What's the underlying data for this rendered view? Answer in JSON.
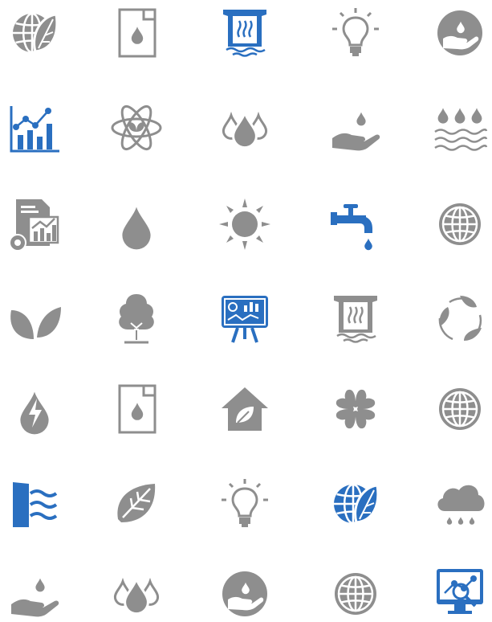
{
  "colors": {
    "gray": "#8e8e8e",
    "blue": "#2a6fc0",
    "white": "#ffffff"
  },
  "icons": [
    {
      "name": "globe-leaf-icon",
      "color": "gray"
    },
    {
      "name": "document-drop-icon",
      "color": "gray"
    },
    {
      "name": "dam-icon",
      "color": "blue"
    },
    {
      "name": "lightbulb-icon",
      "color": "gray"
    },
    {
      "name": "hand-water-circle-icon",
      "color": "gray"
    },
    {
      "name": "chart-growth-icon",
      "color": "blue"
    },
    {
      "name": "atom-leaf-icon",
      "color": "gray"
    },
    {
      "name": "triple-drops-icon",
      "color": "gray"
    },
    {
      "name": "hand-drop-icon",
      "color": "gray"
    },
    {
      "name": "drops-waves-icon",
      "color": "gray"
    },
    {
      "name": "report-gear-icon",
      "color": "gray"
    },
    {
      "name": "drop-icon",
      "color": "gray"
    },
    {
      "name": "sun-icon",
      "color": "gray"
    },
    {
      "name": "faucet-icon",
      "color": "blue"
    },
    {
      "name": "globe-icon",
      "color": "gray"
    },
    {
      "name": "leaves-icon",
      "color": "gray"
    },
    {
      "name": "tree-icon",
      "color": "gray"
    },
    {
      "name": "presentation-board-icon",
      "color": "blue"
    },
    {
      "name": "dam-icon",
      "color": "gray"
    },
    {
      "name": "recycle-leaves-icon",
      "color": "gray"
    },
    {
      "name": "energy-drop-icon",
      "color": "gray"
    },
    {
      "name": "document-drop-icon",
      "color": "gray"
    },
    {
      "name": "eco-house-icon",
      "color": "gray"
    },
    {
      "name": "clover-icon",
      "color": "gray"
    },
    {
      "name": "globe-icon",
      "color": "gray"
    },
    {
      "name": "hydro-dam-icon",
      "color": "blue"
    },
    {
      "name": "leaf-icon",
      "color": "gray"
    },
    {
      "name": "lightbulb-icon",
      "color": "gray"
    },
    {
      "name": "globe-leaf-icon",
      "color": "blue"
    },
    {
      "name": "rain-cloud-icon",
      "color": "gray"
    },
    {
      "name": "hand-drop-icon",
      "color": "gray"
    },
    {
      "name": "triple-drops-icon",
      "color": "gray"
    },
    {
      "name": "hand-water-circle-icon",
      "color": "gray"
    },
    {
      "name": "globe-icon",
      "color": "gray"
    },
    {
      "name": "monitor-analytics-icon",
      "color": "blue"
    }
  ]
}
